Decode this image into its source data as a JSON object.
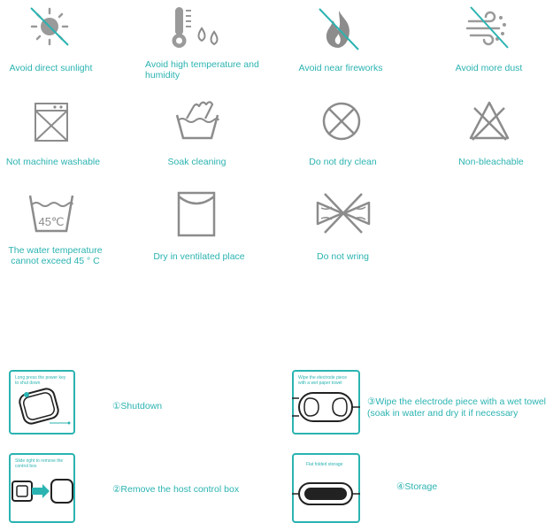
{
  "care_labels": [
    {
      "id": "sun",
      "text": "Avoid direct sunlight",
      "icon": "no-sunlight-icon"
    },
    {
      "id": "temp",
      "text": "Avoid high temperature and humidity",
      "icon": "no-high-temperature-humidity-icon"
    },
    {
      "id": "fire",
      "text": "Avoid near fireworks",
      "icon": "no-fire-icon"
    },
    {
      "id": "dust",
      "text": "Avoid more dust",
      "icon": "no-dust-icon"
    },
    {
      "id": "machine",
      "text": "Not machine washable",
      "icon": "no-machine-wash-icon"
    },
    {
      "id": "soak",
      "text": "Soak cleaning",
      "icon": "hand-wash-icon"
    },
    {
      "id": "dryclean",
      "text": "Do not dry clean",
      "icon": "no-dry-clean-icon"
    },
    {
      "id": "bleach",
      "text": "Non-bleachable",
      "icon": "no-bleach-icon"
    },
    {
      "id": "water",
      "text": "The water temperature cannot exceed 45 ° C",
      "icon": "wash-45c-icon",
      "icon_text": "45℃"
    },
    {
      "id": "ventilated",
      "text": "Dry in ventilated place",
      "icon": "dry-ventilated-icon"
    },
    {
      "id": "wring",
      "text": "Do not wring",
      "icon": "no-wring-icon"
    }
  ],
  "steps": [
    {
      "id": "shutdown",
      "hint": "Long press the power key to shut down",
      "text": "①Shutdown"
    },
    {
      "id": "wipe",
      "hint": "Wipe the electrode piece with a wet paper towel",
      "text": "③Wipe the electrode piece with a wet towel (soak in water and dry it if necessary"
    },
    {
      "id": "remove",
      "hint": "Slide right to remove the control box",
      "text": "②Remove the host control box"
    },
    {
      "id": "storage",
      "hint": "Flat folded storage",
      "text": "④Storage"
    }
  ],
  "colors": {
    "accent": "#2bb3b1",
    "icon_gray": "#8c8c8c"
  }
}
